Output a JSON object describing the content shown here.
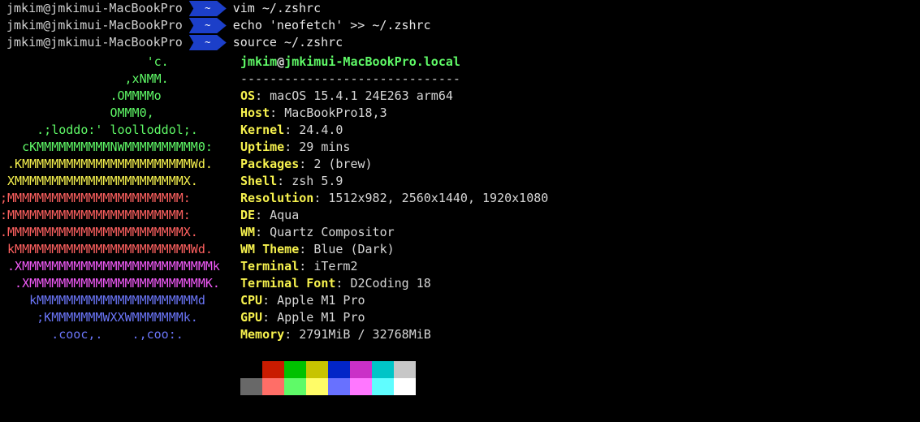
{
  "terminal": {
    "background": "#000000",
    "commands": [
      {
        "prompt": "jmkim@jmkimui-MacBookPro",
        "arrow": "~",
        "command": "vim ~/.zshrc"
      },
      {
        "prompt": "jmkim@jmkimui-MacBookPro",
        "arrow": "~",
        "command": "echo 'neofetch' >> ~/.zshrc"
      },
      {
        "prompt": "jmkim@jmkimui-MacBookPro",
        "arrow": "~",
        "command": "source ~/.zshrc"
      }
    ],
    "logo": {
      "lines": [
        {
          "text": "                    'c.",
          "color": "#5ff967"
        },
        {
          "text": "                 ,xNMM.",
          "color": "#5ff967"
        },
        {
          "text": "               .OMMMMo",
          "color": "#5ff967"
        },
        {
          "text": "               OMMM0,",
          "color": "#5ff967"
        },
        {
          "text": "     .;loddo:' loolloddol;.",
          "color": "#5ff967"
        },
        {
          "text": "   cKMMMMMMMMMMNWMMMMMMMMMM0:",
          "color": "#5ff967"
        },
        {
          "text": " .KMMMMMMMMMMMMMMMMMMMMMMMWd.",
          "color": "#f7f24e"
        },
        {
          "text": " XMMMMMMMMMMMMMMMMMMMMMMMX.",
          "color": "#f7f24e"
        },
        {
          "text": ";MMMMMMMMMMMMMMMMMMMMMMMM:",
          "color": "#ff6160"
        },
        {
          "text": ":MMMMMMMMMMMMMMMMMMMMMMMM:",
          "color": "#ff6160"
        },
        {
          "text": ".MMMMMMMMMMMMMMMMMMMMMMMMX.",
          "color": "#ff6160"
        },
        {
          "text": " kMMMMMMMMMMMMMMMMMMMMMMMMWd.",
          "color": "#ff6160"
        },
        {
          "text": " .XMMMMMMMMMMMMMMMMMMMMMMMMMMk",
          "color": "#f35bfa"
        },
        {
          "text": "  .XMMMMMMMMMMMMMMMMMMMMMMMMK.",
          "color": "#f35bfa"
        },
        {
          "text": "    kMMMMMMMMMMMMMMMMMMMMMMd",
          "color": "#6a75f7"
        },
        {
          "text": "     ;KMMMMMMMWXXWMMMMMMMk.",
          "color": "#6a75f7"
        },
        {
          "text": "       .cooc,.    .,coo:.",
          "color": "#6a75f7"
        }
      ]
    },
    "info": {
      "user": "jmkim",
      "at": "@",
      "host": "jmkimui-MacBookPro.local",
      "underline": "------------------------------",
      "fields": [
        {
          "key": "OS",
          "value": "macOS 15.4.1 24E263 arm64"
        },
        {
          "key": "Host",
          "value": "MacBookPro18,3"
        },
        {
          "key": "Kernel",
          "value": "24.4.0"
        },
        {
          "key": "Uptime",
          "value": "29 mins"
        },
        {
          "key": "Packages",
          "value": "2 (brew)"
        },
        {
          "key": "Shell",
          "value": "zsh 5.9"
        },
        {
          "key": "Resolution",
          "value": "1512x982, 2560x1440, 1920x1080"
        },
        {
          "key": "DE",
          "value": "Aqua"
        },
        {
          "key": "WM",
          "value": "Quartz Compositor"
        },
        {
          "key": "WM Theme",
          "value": "Blue (Dark)"
        },
        {
          "key": "Terminal",
          "value": "iTerm2"
        },
        {
          "key": "Terminal Font",
          "value": "D2Coding 18"
        },
        {
          "key": "CPU",
          "value": "Apple M1 Pro"
        },
        {
          "key": "GPU",
          "value": "Apple M1 Pro"
        },
        {
          "key": "Memory",
          "value": "2791MiB / 32768MiB"
        }
      ]
    },
    "palette": {
      "normal": [
        "#000000",
        "#c91b00",
        "#00c200",
        "#c7c400",
        "#0225c7",
        "#ca30c7",
        "#00c5c7",
        "#c7c7c7"
      ],
      "bright": [
        "#686868",
        "#ff6e67",
        "#5ffa68",
        "#fffc67",
        "#6871ff",
        "#ff77ff",
        "#60fdff",
        "#ffffff"
      ]
    }
  }
}
